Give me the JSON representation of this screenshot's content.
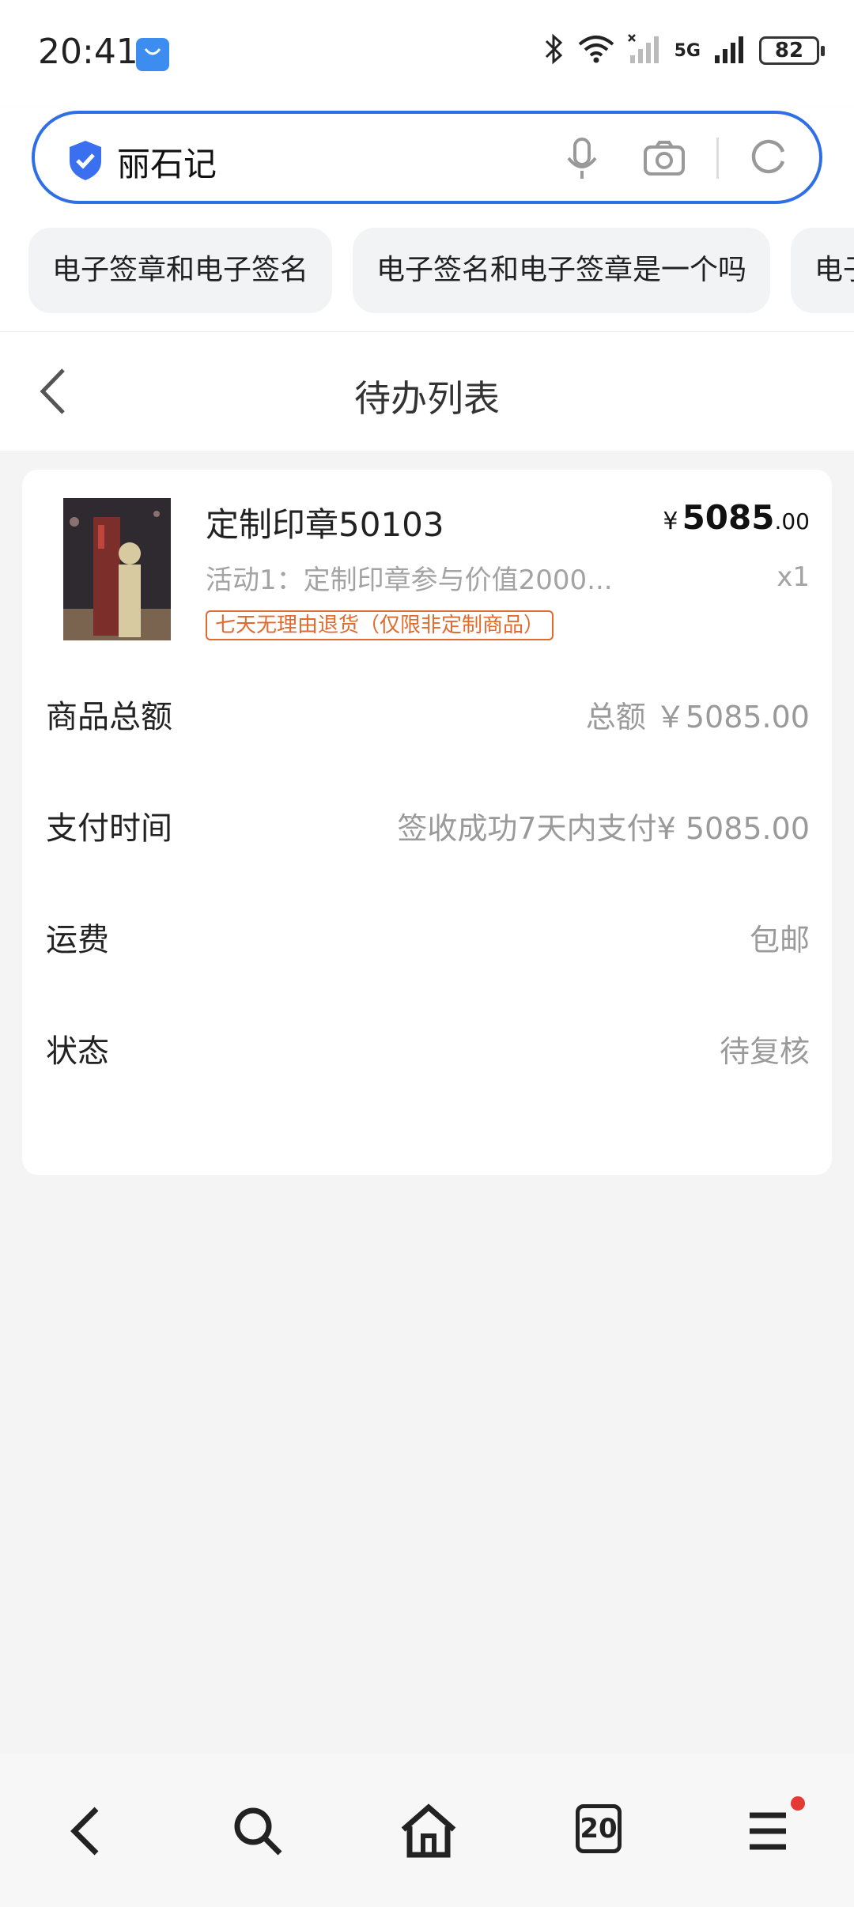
{
  "status_bar": {
    "time": "20:41",
    "network_label": "5G",
    "battery": "82",
    "icons": [
      "app-store-icon",
      "bluetooth-icon",
      "wifi-icon",
      "signal-icon",
      "battery-icon"
    ]
  },
  "search": {
    "query": "丽石记",
    "icons": [
      "shield-check-icon",
      "microphone-icon",
      "camera-icon",
      "refresh-icon"
    ]
  },
  "suggestions": [
    "电子签章和电子签名",
    "电子签名和电子签章是一个吗",
    "电子"
  ],
  "header": {
    "title": "待办列表"
  },
  "order": {
    "product_name": "定制印章50103",
    "price_currency": "¥",
    "price_integer": "5085",
    "price_decimal": ".00",
    "activity": "活动1：定制印章参与价值2000...",
    "quantity": "x1",
    "return_policy": "七天无理由退货（仅限非定制商品）",
    "details": [
      {
        "label": "商品总额",
        "value": "总额 ￥5085.00"
      },
      {
        "label": "支付时间",
        "value": "签收成功7天内支付¥ 5085.00"
      },
      {
        "label": "运费",
        "value": "包邮"
      },
      {
        "label": "状态",
        "value": "待复核"
      }
    ]
  },
  "bottom_nav": {
    "tabs_count": "20",
    "icons": [
      "back-icon",
      "search-icon",
      "home-icon",
      "tabs-icon",
      "menu-icon"
    ],
    "accent_color": "#e53935"
  },
  "colors": {
    "accent": "#2f6fe6",
    "badge": "#e26a2c"
  }
}
